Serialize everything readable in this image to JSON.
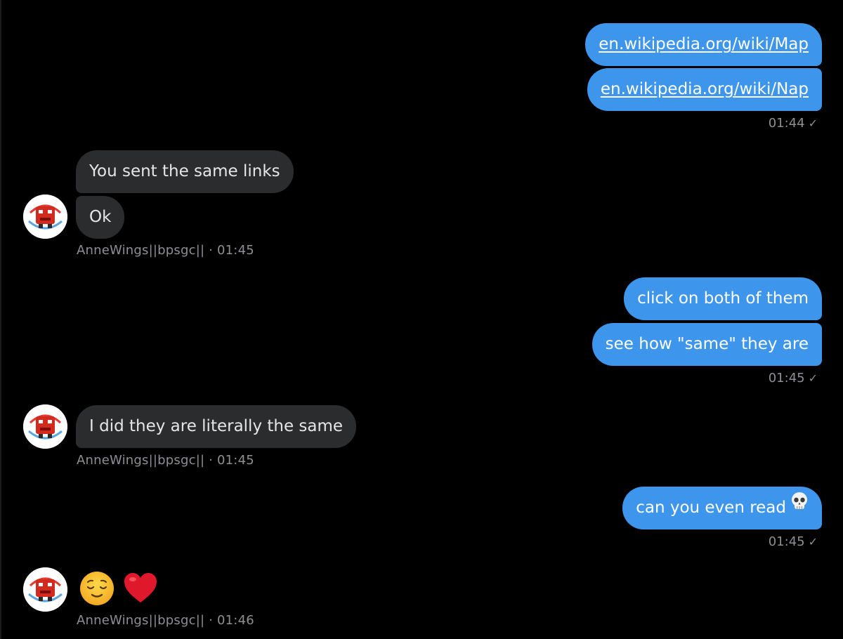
{
  "contact": {
    "name": "AnneWings||bpsgc||"
  },
  "colors": {
    "background": "#000000",
    "outgoing_bubble": "#3d95ec",
    "incoming_bubble": "#2b2c2e",
    "meta_text": "#8e8e93"
  },
  "messages": {
    "out1": {
      "line1": "en.wikipedia.org/wiki/Map",
      "line2": "en.wikipedia.org/wiki/Nap",
      "time": "01:44",
      "status_icon": "sent-check-icon"
    },
    "in1": {
      "line1": "You sent the same links",
      "line2": "Ok",
      "meta": "AnneWings||bpsgc|| · 01:45"
    },
    "out2": {
      "line1": "click on both of them",
      "line2": "see how \"same\" they are",
      "time": "01:45",
      "status_icon": "sent-check-icon"
    },
    "in2": {
      "line1": "I did they are literally the same",
      "meta": "AnneWings||bpsgc|| · 01:45"
    },
    "out3": {
      "line1": "can you even read",
      "emoji": "skull-emoji",
      "time": "01:45",
      "status_icon": "sent-check-icon"
    },
    "in3": {
      "emojis": [
        "relieved-face-emoji",
        "red-heart-emoji"
      ],
      "meta": "AnneWings||bpsgc|| · 01:46"
    }
  }
}
